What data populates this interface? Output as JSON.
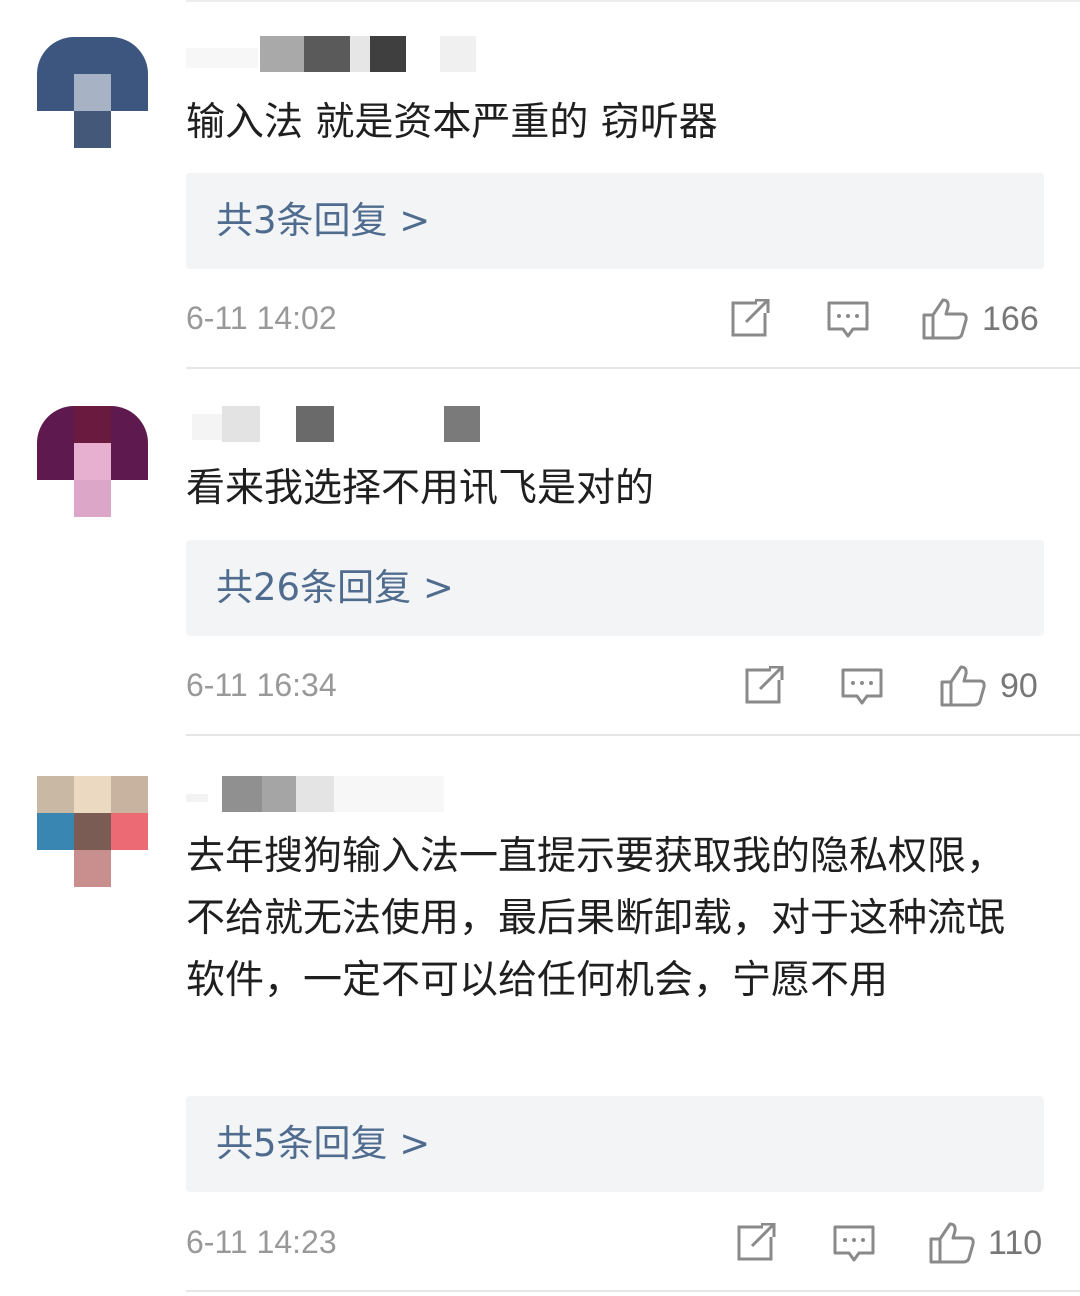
{
  "comments": [
    {
      "text": "输入法 就是资本严重的 窃听器",
      "replies": "共3条回复 >",
      "time": "6-11 14:02",
      "likes": "166",
      "icons": [
        "share-icon",
        "comment-icon",
        "like-icon"
      ]
    },
    {
      "text": "看来我选择不用讯飞是对的",
      "replies": "共26条回复 >",
      "time": "6-11 16:34",
      "likes": "90",
      "icons": [
        "share-icon",
        "comment-icon",
        "like-icon"
      ]
    },
    {
      "text": "去年搜狗输入法一直提示要获取我的隐私权限，不给就无法使用，最后果断卸载，对于这种流氓软件，一定不可以给任何机会，宁愿不用",
      "replies": "共5条回复 >",
      "time": "6-11 14:23",
      "likes": "110",
      "icons": [
        "share-icon",
        "comment-icon",
        "like-icon"
      ]
    }
  ],
  "colors": {
    "text": "#1f1f1f",
    "link": "#4f6c8f",
    "meta": "#999999",
    "reply_bg": "#f3f4f6",
    "divider": "#e6e6e6"
  }
}
